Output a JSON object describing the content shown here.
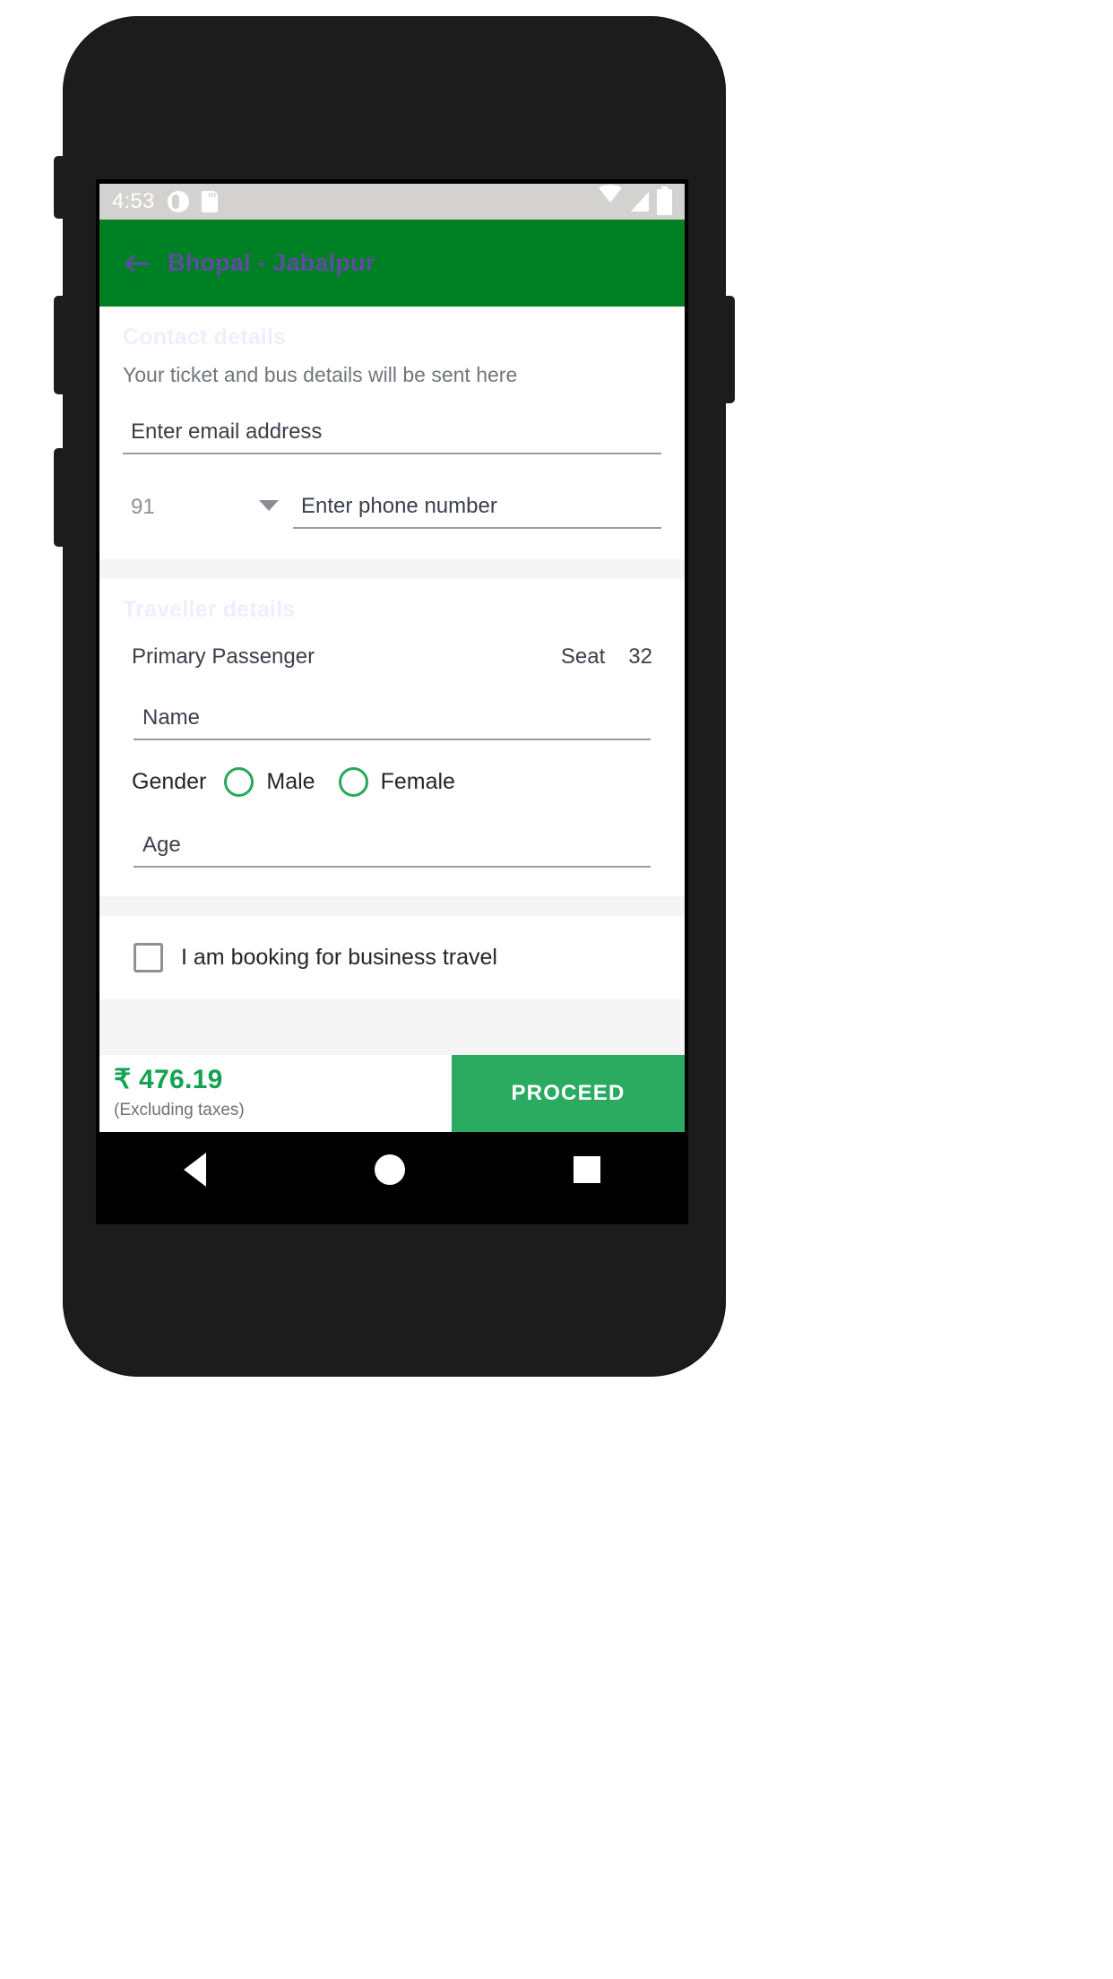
{
  "status_bar": {
    "time": "4:53",
    "left_icons": [
      "alarm-icon",
      "sd-card-icon"
    ],
    "right_icons": [
      "wifi-icon",
      "signal-icon",
      "battery-icon"
    ]
  },
  "app_bar": {
    "back_icon": "back-arrow-icon",
    "title": "Bhopal - Jabalpur",
    "background": "#008024",
    "title_color": "#5b4f9e"
  },
  "contact_section": {
    "heading": "Contact details",
    "subtitle": "Your ticket and bus details will be sent here",
    "email": {
      "placeholder": "Enter email address",
      "value": ""
    },
    "country_code": {
      "value": "91",
      "caret_icon": "chevron-down-icon"
    },
    "phone": {
      "placeholder": "Enter phone number",
      "value": ""
    }
  },
  "traveller_section": {
    "heading": "Traveller details",
    "passenger_label": "Primary Passenger",
    "seat_label": "Seat",
    "seat_number": "32",
    "name": {
      "placeholder": "Name",
      "value": ""
    },
    "gender_label": "Gender",
    "gender_options": [
      {
        "label": "Male",
        "selected": false
      },
      {
        "label": "Female",
        "selected": false
      }
    ],
    "age": {
      "placeholder": "Age",
      "value": ""
    }
  },
  "business_travel": {
    "label": "I am booking for business travel",
    "checked": false
  },
  "bottom_bar": {
    "fare": "₹ 476.19",
    "fare_note": "(Excluding taxes)",
    "proceed_label": "PROCEED",
    "proceed_color": "#2bab62",
    "fare_color": "#12a252"
  },
  "nav_bar": {
    "back": "nav-back-icon",
    "home": "nav-home-icon",
    "recents": "nav-recents-icon"
  }
}
